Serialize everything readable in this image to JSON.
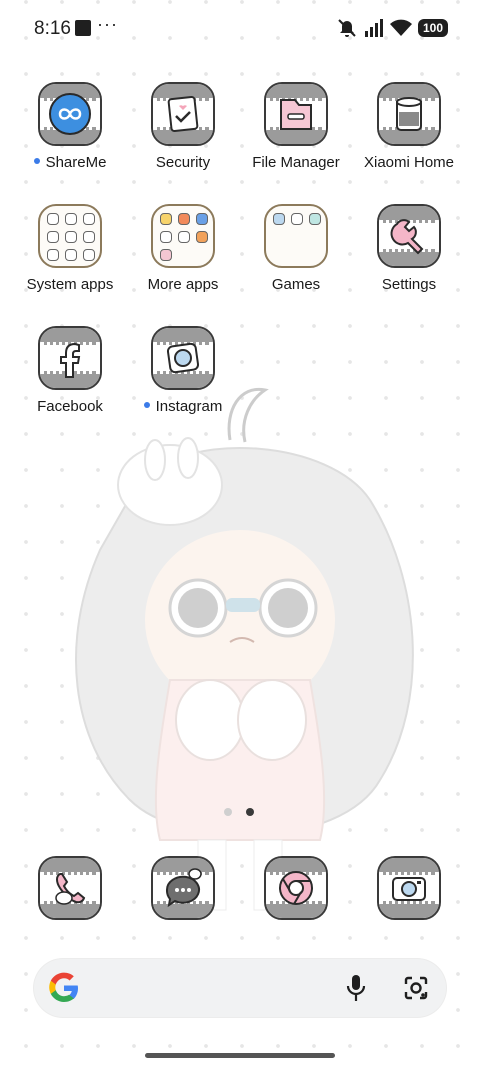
{
  "status_bar": {
    "time": "8:16",
    "more_notifications": "···",
    "battery": "100",
    "icons": [
      "notification-square-icon",
      "mute-vibrate-icon",
      "cellular-signal-icon",
      "wifi-icon",
      "battery-icon"
    ]
  },
  "apps": {
    "shareme": {
      "label": "ShareMe",
      "new_dot": true
    },
    "security": {
      "label": "Security"
    },
    "file_manager": {
      "label": "File Manager"
    },
    "xiaomi_home": {
      "label": "Xiaomi Home"
    },
    "system_apps": {
      "label": "System apps"
    },
    "more_apps": {
      "label": "More apps"
    },
    "games": {
      "label": "Games"
    },
    "settings": {
      "label": "Settings"
    },
    "facebook": {
      "label": "Facebook"
    },
    "instagram": {
      "label": "Instagram",
      "new_dot": true
    }
  },
  "page_indicator": {
    "pages": 2,
    "current": 2
  },
  "dock": [
    "phone-icon",
    "messages-icon",
    "chrome-icon",
    "camera-icon"
  ],
  "search": {
    "google_logo": "G",
    "icons": [
      "google-logo-icon",
      "mic-icon",
      "google-lens-icon"
    ]
  },
  "colors": {
    "notification_dot": "#3b7be8",
    "icon_lace": "#9b9b9b",
    "icon_outline": "#3a3a3a"
  }
}
